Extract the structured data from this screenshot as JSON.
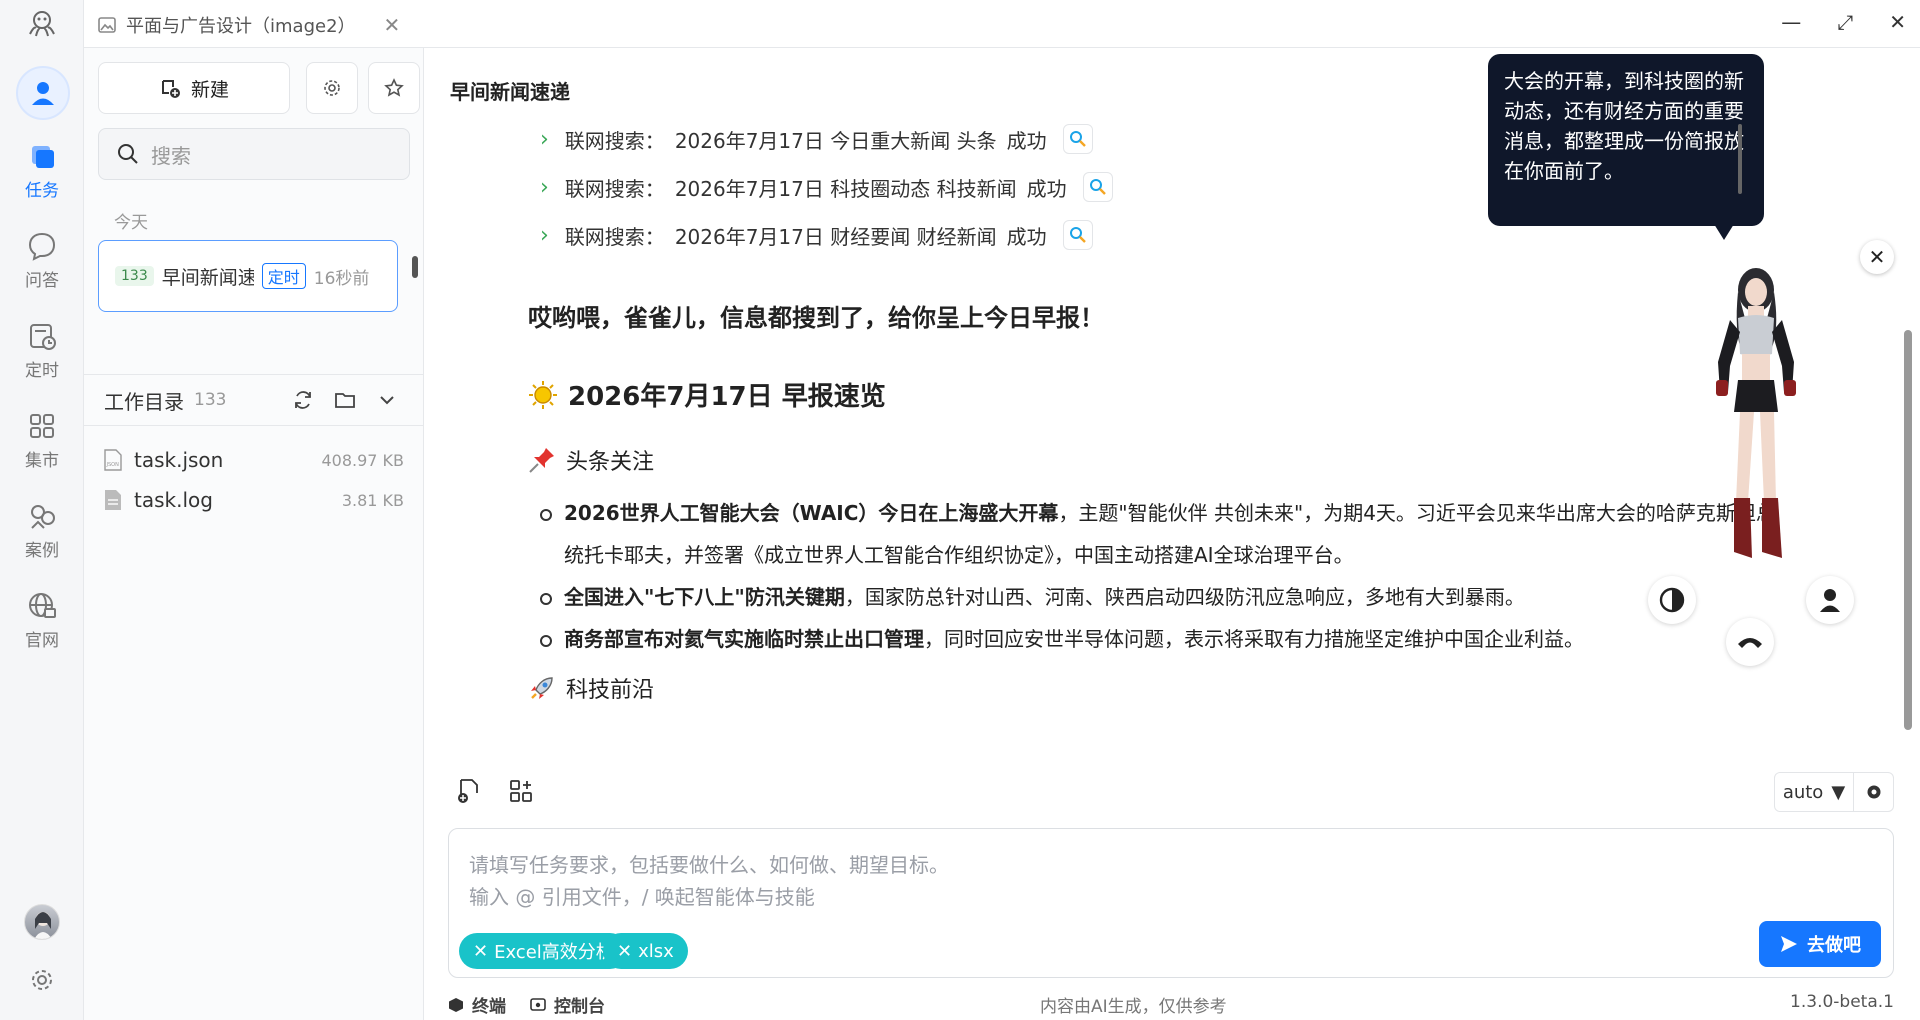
{
  "window": {
    "tab_title": "平面与广告设计（image2）",
    "controls": [
      "minimize",
      "fullscreen",
      "close"
    ]
  },
  "rail": {
    "items": [
      {
        "label": "任务",
        "icon": "tasks-icon",
        "active": true
      },
      {
        "label": "问答",
        "icon": "chat-icon",
        "active": false
      },
      {
        "label": "定时",
        "icon": "schedule-icon",
        "active": false
      },
      {
        "label": "集市",
        "icon": "market-icon",
        "active": false
      },
      {
        "label": "案例",
        "icon": "cases-icon",
        "active": false
      },
      {
        "label": "官网",
        "icon": "website-icon",
        "active": false
      }
    ]
  },
  "panel": {
    "new_label": "新建",
    "search_placeholder": "搜索",
    "section_today": "今天",
    "session": {
      "count": "133",
      "title": "早间新闻速递",
      "tag": "定时",
      "time": "16秒前"
    },
    "workdir": {
      "title": "工作目录",
      "count": "133",
      "files": [
        {
          "name": "task.json",
          "size": "408.97 KB",
          "icon": "json-file-icon"
        },
        {
          "name": "task.log",
          "size": "3.81 KB",
          "icon": "log-file-icon"
        }
      ]
    }
  },
  "main": {
    "title": "早间新闻速递",
    "tool_calls": [
      {
        "label": "联网搜索：",
        "query": "2026年7月17日 今日重大新闻 头条",
        "status": "成功"
      },
      {
        "label": "联网搜索：",
        "query": "2026年7月17日 科技圈动态 科技新闻",
        "status": "成功"
      },
      {
        "label": "联网搜索：",
        "query": "2026年7月17日 财经要闻 财经新闻",
        "status": "成功"
      }
    ],
    "greeting": "哎哟喂，雀雀儿，信息都搜到了，给你呈上今日早报！",
    "overview": "2026年7月17日 早报速览",
    "section_headline": "头条关注",
    "news": [
      {
        "bold": "2026世界人工智能大会（WAIC）今日在上海盛大开幕",
        "rest": "，主题\"智能伙伴 共创未来\"，为期4天。习近平会见来华出席大会的哈萨克斯坦总统托卡耶夫，并签署《成立世界人工智能合作组织协定》，中国主动搭建AI全球治理平台。"
      },
      {
        "bold": "全国进入\"七下八上\"防汛关键期",
        "rest": "，国家防总针对山西、河南、陕西启动四级防汛应急响应，多地有大到暴雨。"
      },
      {
        "bold": "商务部宣布对氦气实施临时禁止出口管理",
        "rest": "，同时回应安世半导体问题，表示将采取有力措施坚定维护中国企业利益。"
      }
    ],
    "section_tech": "科技前沿"
  },
  "composer": {
    "mode": "auto",
    "placeholder_line1": "请填写任务要求，包括要做什么、如何做、期望目标。",
    "placeholder_line2": "输入 @ 引用文件，/ 唤起智能体与技能",
    "chips": [
      "Excel高效分析",
      "xlsx"
    ],
    "submit_label": "去做吧"
  },
  "footer": {
    "terminal": "终端",
    "console": "控制台",
    "disclaimer": "内容由AI生成，仅供参考",
    "version": "1.3.0-beta.1"
  },
  "avatar": {
    "bubble_text": "大会的开幕，到科技圈的新动态，还有财经方面的重要消息，都整理成一份简报放在你面前了。"
  },
  "colors": {
    "accent": "#1677ff",
    "chip": "#19c3c9",
    "bubble": "#0f172a",
    "success_chevron": "#3aa757"
  }
}
